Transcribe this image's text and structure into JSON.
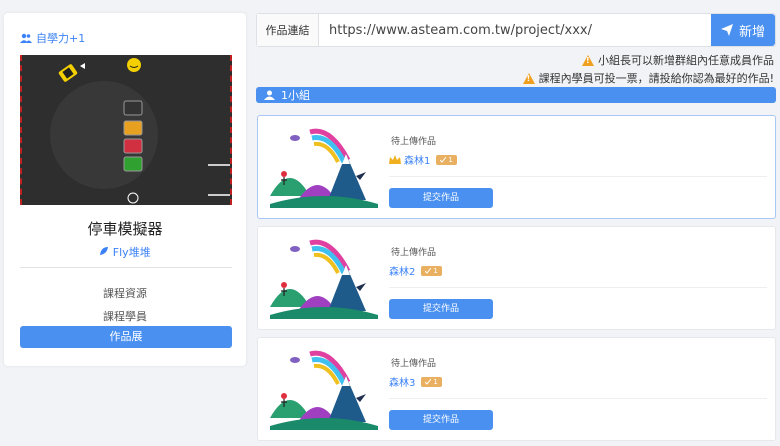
{
  "left_panel": {
    "group_tag": "自學力+1",
    "project_title": "停車模擬器",
    "author": "Fly堆堆",
    "links": [
      "課程資源",
      "課程學員"
    ],
    "gallery_button": "作品展"
  },
  "url_bar": {
    "label": "作品連結",
    "value": "https://www.asteam.com.tw/project/xxx/",
    "add_button": "新增"
  },
  "notes": [
    "小組長可以新增群組內任意成員作品",
    "課程內學員可投一票，請投給你認為最好的作品!"
  ],
  "group": {
    "label": "1小組"
  },
  "cards": [
    {
      "status": "待上傳作品",
      "name": "森林1",
      "badge": "1",
      "submit": "提交作品",
      "leader": true
    },
    {
      "status": "待上傳作品",
      "name": "森林2",
      "badge": "1",
      "submit": "提交作品",
      "leader": false
    },
    {
      "status": "待上傳作品",
      "name": "森林3",
      "badge": "1",
      "submit": "提交作品",
      "leader": false
    }
  ],
  "colors": {
    "accent": "#4a90f0",
    "warning": "#f0a020",
    "badge": "#e8b060"
  }
}
